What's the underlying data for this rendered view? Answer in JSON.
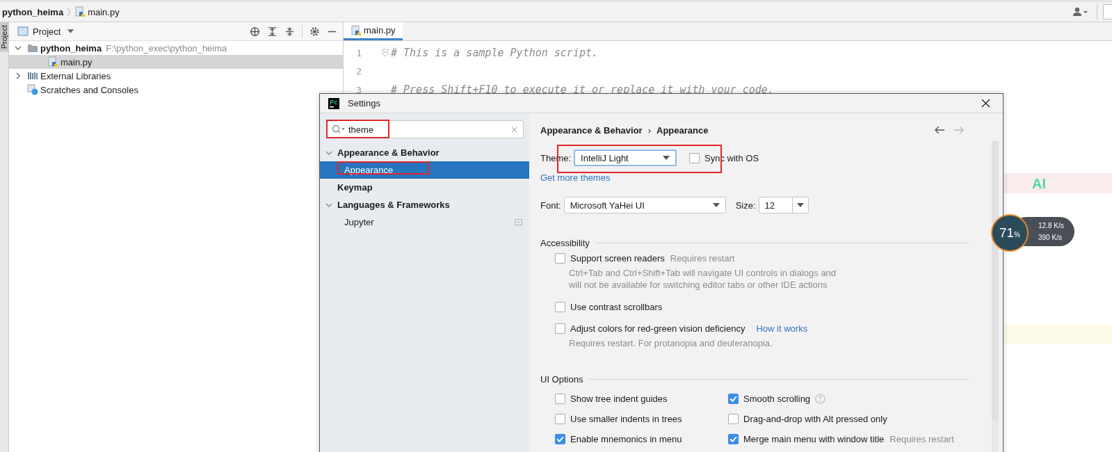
{
  "navbar": {
    "breadcrumbs": [
      "python_heima",
      "main.py"
    ]
  },
  "tool_strip": {
    "label": "Project"
  },
  "project_panel": {
    "title": "Project",
    "tree": [
      {
        "label": "python_heima",
        "path": "F:\\python_exec\\python_heima",
        "kind": "folder",
        "expanded": true,
        "selected": false,
        "children": [
          {
            "label": "main.py",
            "kind": "python",
            "selected": true
          }
        ]
      },
      {
        "label": "External Libraries",
        "kind": "library",
        "expanded": false,
        "selected": false
      },
      {
        "label": "Scratches and Consoles",
        "kind": "scratch",
        "selected": false
      }
    ]
  },
  "editor": {
    "tab": "main.py",
    "lines": [
      {
        "number": "1",
        "code": "# This is a sample Python script."
      },
      {
        "number": "2"
      },
      {
        "number": "3",
        "code": "# Press Shift+F10 to execute it or replace it with your code."
      }
    ],
    "inlay": "AI"
  },
  "settings": {
    "title": "Settings",
    "search": {
      "value": "theme"
    },
    "nav": [
      {
        "label": "Appearance & Behavior",
        "expanded": true,
        "selected": false,
        "children": [
          {
            "label": "Appearance",
            "selected": true
          }
        ]
      },
      {
        "label": "Keymap",
        "selected": false
      },
      {
        "label": "Languages & Frameworks",
        "expanded": true,
        "selected": false,
        "children": [
          {
            "label": "Jupyter",
            "selected": false
          }
        ]
      }
    ],
    "breadcrumb": [
      "Appearance & Behavior",
      "Appearance"
    ],
    "breadcrumb_separator": "›",
    "theme": {
      "label": "Theme:",
      "value": "IntelliJ Light"
    },
    "sync": {
      "label": "Sync with OS",
      "checked": false
    },
    "more_themes_link": "Get more themes",
    "font": {
      "label": "Font:",
      "value": "Microsoft YaHei UI"
    },
    "size": {
      "label": "Size:",
      "value": "12"
    },
    "sections": [
      {
        "title": "Accessibility",
        "options": [
          {
            "label": "Support screen readers",
            "checked": false,
            "note": "Requires restart",
            "description": [
              "Ctrl+Tab and Ctrl+Shift+Tab will navigate UI controls in dialogs and",
              "will not be available for switching editor tabs or other IDE actions"
            ]
          },
          {
            "label": "Use contrast scrollbars",
            "checked": false
          },
          {
            "label": "Adjust colors for red-green vision deficiency",
            "checked": false,
            "link": "How it works",
            "description": [
              "Requires restart. For protanopia and deuteranopia."
            ]
          }
        ]
      },
      {
        "title": "UI Options",
        "options": [
          {
            "label": "Show tree indent guides",
            "checked": false
          },
          {
            "label": "Smooth scrolling",
            "checked": true,
            "help": true
          },
          {
            "label": "Use smaller indents in trees",
            "checked": false
          },
          {
            "label": "Drag-and-drop with Alt pressed only",
            "checked": false
          },
          {
            "label": "Enable mnemonics in menu",
            "checked": true
          },
          {
            "label": "Merge main menu with window title",
            "checked": true,
            "note": "Requires restart"
          }
        ]
      }
    ]
  },
  "net_widget": {
    "percent": "71",
    "percent_unit": "%",
    "upload": "12.8 K/s",
    "download": "390 K/s"
  }
}
